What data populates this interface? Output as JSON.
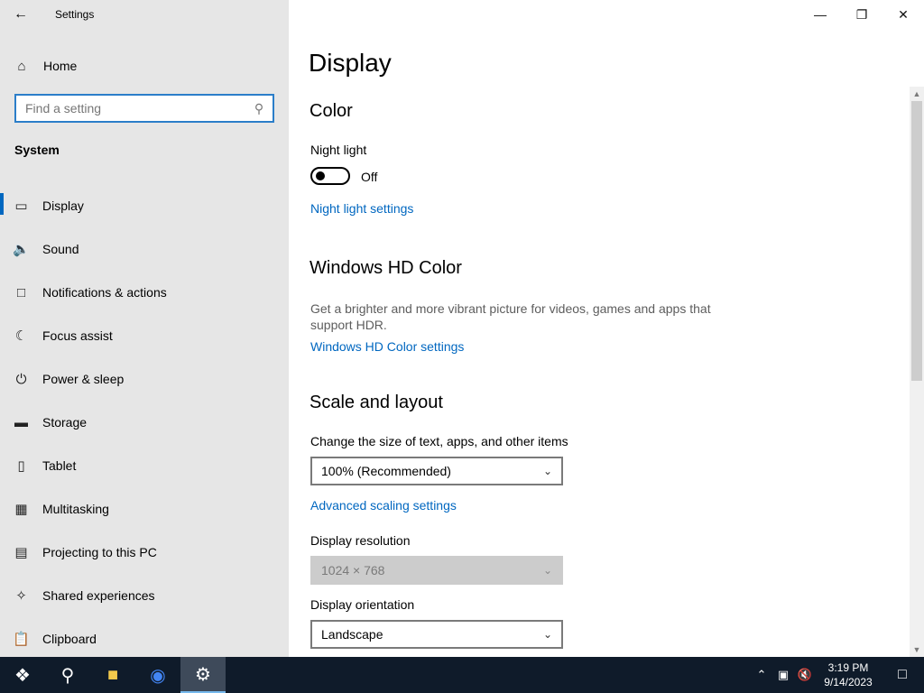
{
  "window": {
    "title": "Settings",
    "back_icon": "arrow-left-icon",
    "controls": [
      "minimize",
      "restore",
      "close"
    ]
  },
  "sidebar": {
    "home_label": "Home",
    "search_placeholder": "Find a setting",
    "group_heading": "System",
    "items": [
      {
        "label": "Display",
        "icon": "monitor-icon",
        "active": true
      },
      {
        "label": "Sound",
        "icon": "speaker-icon"
      },
      {
        "label": "Notifications & actions",
        "icon": "notification-icon"
      },
      {
        "label": "Focus assist",
        "icon": "moon-icon"
      },
      {
        "label": "Power & sleep",
        "icon": "power-icon"
      },
      {
        "label": "Storage",
        "icon": "storage-icon"
      },
      {
        "label": "Tablet",
        "icon": "tablet-icon"
      },
      {
        "label": "Multitasking",
        "icon": "multitasking-icon"
      },
      {
        "label": "Projecting to this PC",
        "icon": "projecting-icon"
      },
      {
        "label": "Shared experiences",
        "icon": "shared-icon"
      },
      {
        "label": "Clipboard",
        "icon": "clipboard-icon"
      }
    ]
  },
  "main": {
    "title": "Display",
    "color": {
      "heading": "Color",
      "night_light_label": "Night light",
      "night_light_state": "Off",
      "night_light_link": "Night light settings"
    },
    "hd_color": {
      "heading": "Windows HD Color",
      "description": "Get a brighter and more vibrant picture for videos, games and apps that support HDR.",
      "link": "Windows HD Color settings"
    },
    "scale": {
      "heading": "Scale and layout",
      "size_label": "Change the size of text, apps, and other items",
      "size_value": "100% (Recommended)",
      "advanced_link": "Advanced scaling settings",
      "resolution_label": "Display resolution",
      "resolution_value": "1024 × 768",
      "orientation_label": "Display orientation",
      "orientation_value": "Landscape"
    }
  },
  "taskbar": {
    "apps": [
      "start-icon",
      "search-icon",
      "file-explorer-icon",
      "chrome-icon",
      "settings-icon"
    ],
    "time": "3:19 PM",
    "date": "9/14/2023"
  },
  "colors": {
    "accent": "#0067c0",
    "sidebar_bg": "#e6e6e6",
    "taskbar_bg": "#0f1b2a"
  }
}
